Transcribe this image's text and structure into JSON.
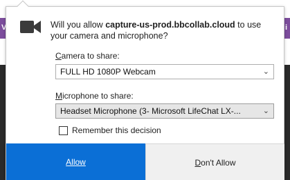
{
  "background": {
    "left_letter": "V",
    "right_letter": "i",
    "purple": "#7c4d9c",
    "dark": "#2a2a2a"
  },
  "dialog": {
    "icon": "camera-icon",
    "message_prefix": "Will you allow ",
    "domain": "capture-us-prod.bbcollab.cloud",
    "message_suffix": " to use your camera and microphone?",
    "camera": {
      "label_access": "C",
      "label_rest": "amera to share:",
      "selected": "FULL HD 1080P Webcam"
    },
    "microphone": {
      "label_access": "M",
      "label_rest": "icrophone to share:",
      "selected": "Headset Microphone (3- Microsoft LifeChat LX-..."
    },
    "remember": {
      "label": "Remember this decision",
      "checked": false
    },
    "allow_button": "Allow",
    "deny_button_access": "D",
    "deny_button_rest": "on't Allow",
    "accent_color": "#0b6fd6"
  }
}
